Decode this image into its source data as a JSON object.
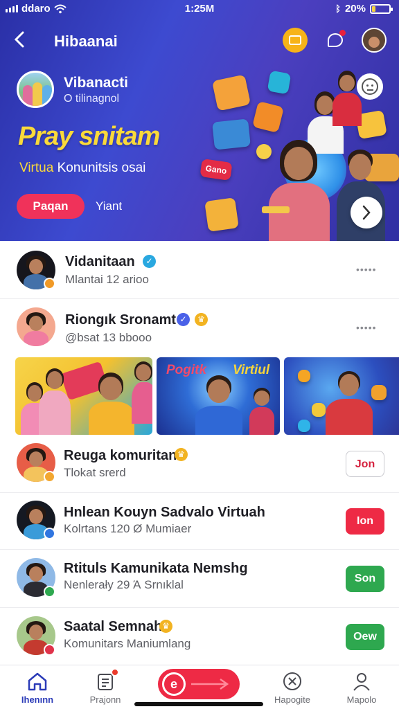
{
  "status": {
    "carrier": "ddaro",
    "time": "1:25M",
    "battery": "20%",
    "battery_level": 0.2
  },
  "nav": {
    "title": "Hibaanai"
  },
  "hero": {
    "name": "Vibanacti",
    "subtitle": "O tilinagnol",
    "title": "Pray snitam",
    "desc_part1": "Virtua",
    "desc_part2": "Konunitsis osai",
    "join_label": "Paqan",
    "view_label": "Yiant",
    "tile_label": "Gano"
  },
  "communities": [
    {
      "title": "Vidanitaan",
      "subtitle": "Mlantai 12 arioo",
      "badge_color": "#29a8e0",
      "more": "•••••"
    },
    {
      "title": "Riongık Sronamt",
      "subtitle": "@bsat 13 bbooo",
      "badge_color": "#4a61e8",
      "more": "•••••"
    }
  ],
  "strip": {
    "caption_a": "Pogitk",
    "caption_b": "Virtiul"
  },
  "suggested": [
    {
      "title": "Reuga komuritan",
      "subtitle": "Tlokat srerd",
      "button": "Jon",
      "button_style": "outline"
    },
    {
      "title": "Hnlean Kouyn Sadvalo Virtuah",
      "subtitle": "Kolrtans 120 Ø Mumiaer",
      "button": "Ion",
      "button_style": "red"
    },
    {
      "title": "Rtituls Kamunikata Nemshg",
      "subtitle": "Nenlerały 29 Ά Srnıklal",
      "button": "Son",
      "button_style": "green"
    },
    {
      "title": "Saatal Semnah",
      "subtitle": "Komunitars Maniumlang",
      "button": "Oew",
      "button_style": "green"
    }
  ],
  "colors": {
    "accent_red": "#ee2a45",
    "accent_green": "#2ea84f",
    "brand_blue": "#2b3bb8",
    "gold": "#f2b321"
  },
  "tabs": [
    {
      "label": "Ihenınn",
      "icon": "home-icon"
    },
    {
      "label": "Prajonn",
      "icon": "clipboard-icon"
    },
    {
      "label": "Hapogite",
      "icon": "close-circle-icon"
    },
    {
      "label": "Mapolo",
      "icon": "person-icon"
    }
  ],
  "center_button": {
    "label": "e"
  }
}
